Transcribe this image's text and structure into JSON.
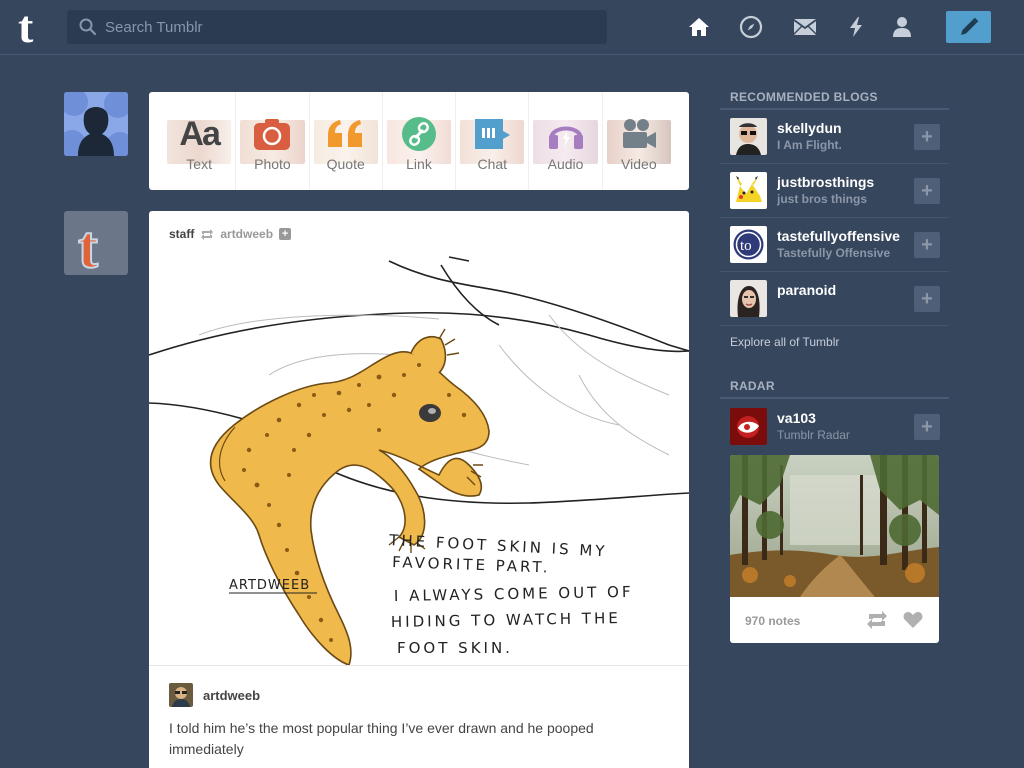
{
  "header": {
    "logo": "t",
    "search_placeholder": "Search Tumblr",
    "nav_icons": [
      "home-icon",
      "explore-compass-icon",
      "inbox-mail-icon",
      "activity-lightning-icon",
      "account-person-icon"
    ],
    "compose_icon": "pencil-icon",
    "accent_color": "#529ecc"
  },
  "post_types": [
    {
      "label": "Text",
      "icon": "text-aa-icon",
      "color": "#444444"
    },
    {
      "label": "Photo",
      "icon": "camera-icon",
      "color": "#d95e40"
    },
    {
      "label": "Quote",
      "icon": "quote-icon",
      "color": "#f2992e"
    },
    {
      "label": "Link",
      "icon": "link-icon",
      "color": "#56bc8a"
    },
    {
      "label": "Chat",
      "icon": "chat-icon",
      "color": "#529ecc"
    },
    {
      "label": "Audio",
      "icon": "headphones-icon",
      "color": "#a77dc2"
    },
    {
      "label": "Video",
      "icon": "video-camera-icon",
      "color": "#748089"
    }
  ],
  "post": {
    "author": "staff",
    "reblogged_from": "artdweeb",
    "image_text": {
      "line1": "THE FOOT SKIN IS MY",
      "line2": "FAVORITE PART.",
      "line3": "I ALWAYS COME OUT OF",
      "line4": "HIDING TO WATCH THE",
      "line5": "FOOT SKIN.",
      "signature": "ARTDWEEB"
    },
    "caption_author": "artdweeb",
    "caption": "I told him he’s the most popular thing I’ve ever drawn and he pooped immediately"
  },
  "sidebar": {
    "recommended_title": "RECOMMENDED BLOGS",
    "blogs": [
      {
        "name": "skellydun",
        "sub": "I Am Flight."
      },
      {
        "name": "justbrosthings",
        "sub": "just bros things"
      },
      {
        "name": "tastefullyoffensive",
        "sub": "Tastefully Offensive"
      },
      {
        "name": "paranoid",
        "sub": ""
      }
    ],
    "explore_label": "Explore all of Tumblr",
    "radar_title": "RADAR",
    "radar_blog": {
      "name": "va103",
      "sub": "Tumblr Radar"
    },
    "radar_notes": "970 notes"
  }
}
